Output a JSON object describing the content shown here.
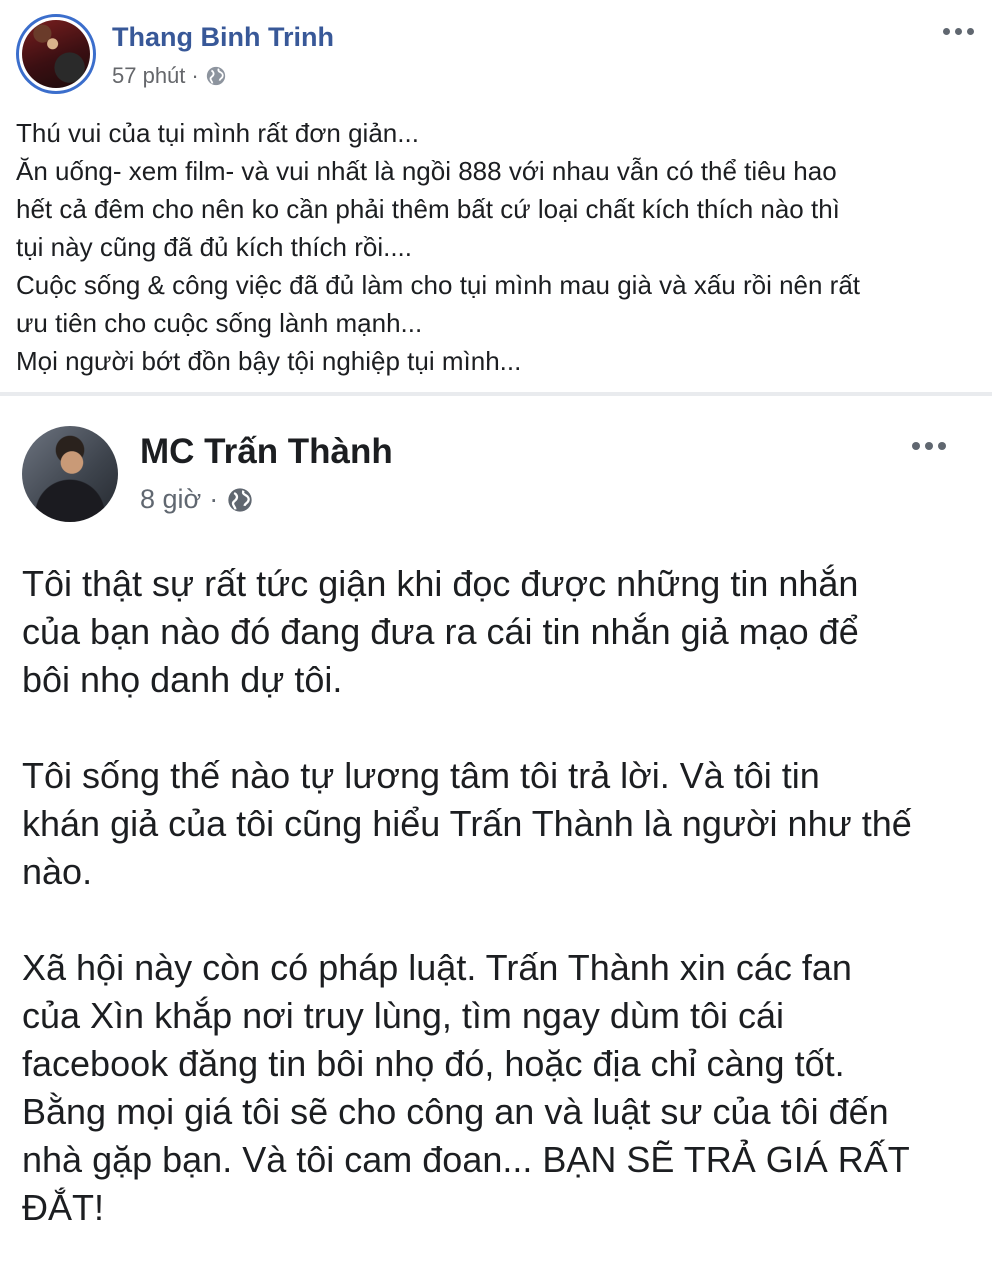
{
  "post_author": {
    "name": "Thang Binh Trinh",
    "time": "57 phút",
    "separator": "·",
    "privacy_icon": "globe-icon"
  },
  "post_body": {
    "lines": [
      "Thú vui của tụi mình rất đơn giản...",
      "Ăn uống- xem film- và vui nhất là ngồi 888 với nhau vẫn có thể tiêu hao",
      "hết cả đêm cho nên ko cần phải thêm bất cứ loại chất kích thích nào thì",
      "tụi này cũng đã đủ kích thích rồi....",
      "Cuộc sống & công việc đã đủ làm cho tụi mình mau già và xấu rồi nên rất",
      "ưu tiên cho cuộc sống lành mạnh...",
      "Mọi người bớt đồn bậy tội nghiệp tụi mình..."
    ]
  },
  "embedded_post": {
    "author": "MC Trấn Thành",
    "time": "8 giờ",
    "separator": "·",
    "privacy_icon": "globe-icon",
    "paragraphs": [
      [
        "Tôi thật sự rất tức giận khi đọc được những tin nhắn",
        "của bạn nào đó đang đưa ra cái tin nhắn giả mạo để",
        "bôi nhọ danh dự tôi."
      ],
      [
        "Tôi sống thế nào tự lương tâm tôi trả lời. Và tôi tin",
        "khán giả của tôi cũng hiểu Trấn Thành là người như thế",
        "nào."
      ],
      [
        "Xã hội này còn có pháp luật. Trấn Thành xin các fan",
        "của Xìn khắp nơi truy lùng, tìm ngay dùm tôi cái",
        "facebook đăng tin bôi nhọ đó, hoặc địa chỉ càng tốt.",
        "Bằng mọi giá tôi sẽ cho công an và luật sư của tôi đến",
        "nhà gặp bạn. Và tôi cam đoan... BẠN SẼ TRẢ GIÁ RẤT",
        "ĐẮT!"
      ]
    ]
  },
  "colors": {
    "author_link": "#385898",
    "text": "#1c1e21",
    "meta": "#65676b",
    "divider": "#e9ebee",
    "avatar_ring": "#3b6ecc"
  }
}
